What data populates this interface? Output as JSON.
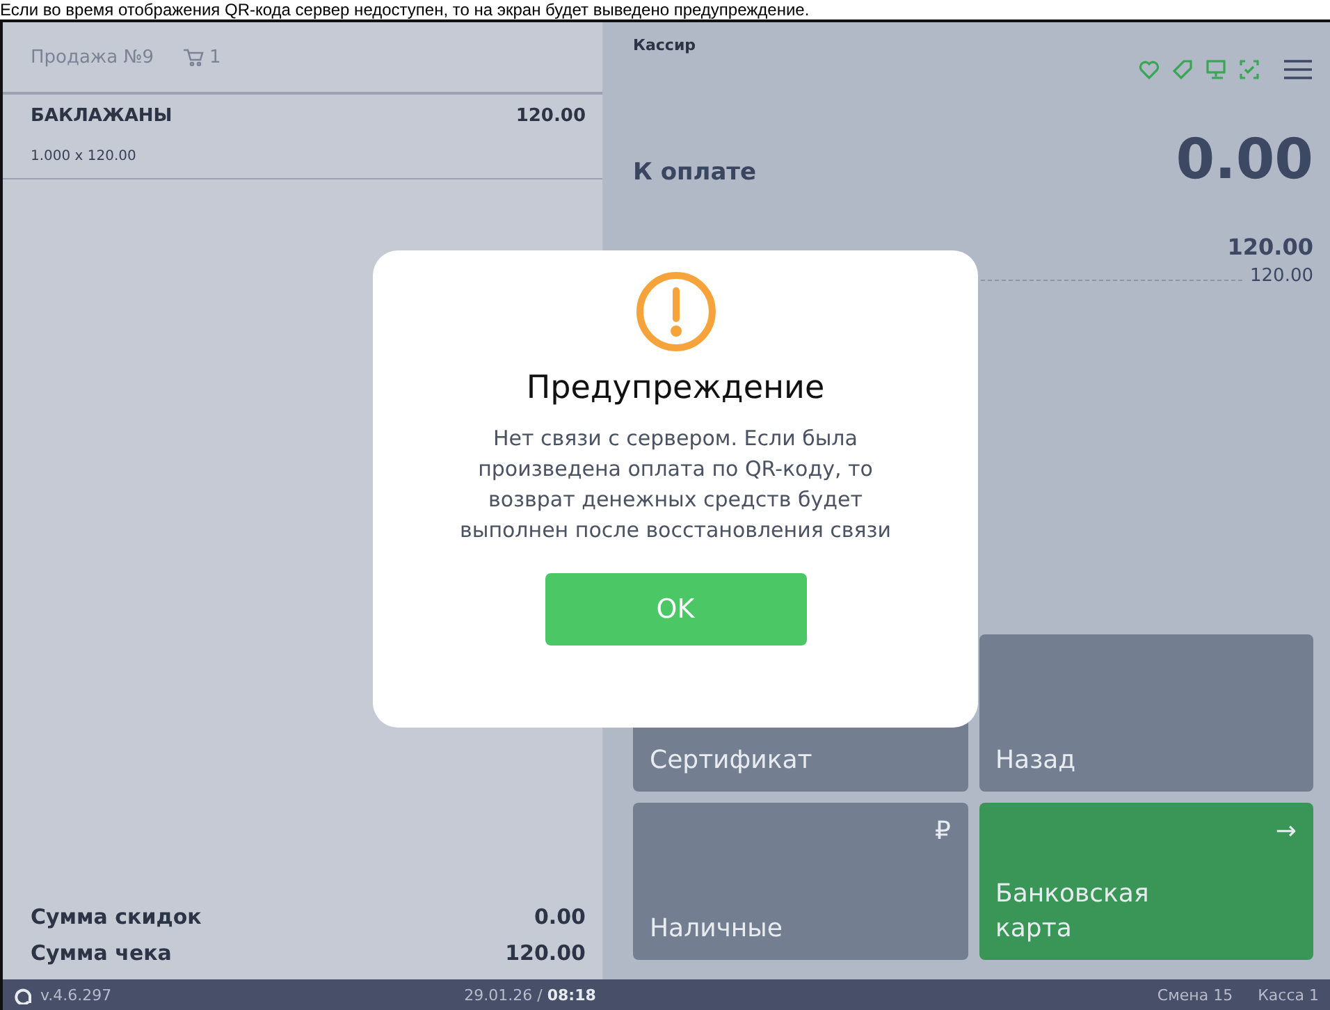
{
  "caption": "Если во время отображения QR-кода сервер недоступен, то на экран будет выведено предупреждение.",
  "sale": {
    "title": "Продажа №9",
    "cart_count": "1"
  },
  "items": [
    {
      "name": "БАКЛАЖАНЫ",
      "amount": "120.00",
      "detail": "1.000 x 120.00"
    }
  ],
  "totals": [
    {
      "label": "Сумма скидок",
      "value": "0.00"
    },
    {
      "label": "Сумма чека",
      "value": "120.00"
    }
  ],
  "cashier": "Кассир",
  "to_pay": {
    "label": "К оплате",
    "value": "0.00"
  },
  "paid": {
    "total": "120.00",
    "line": "120.00"
  },
  "buttons": [
    {
      "label": "Сертификат",
      "kind": "plain"
    },
    {
      "label": "Назад",
      "kind": "plain"
    },
    {
      "label": "Наличные",
      "kind": "cash",
      "icon": "₽"
    },
    {
      "label": "Банковская карта",
      "kind": "card",
      "icon": "→"
    }
  ],
  "dialog": {
    "title": "Предупреждение",
    "message": "Нет связи с сервером. Если была произведена оплата по QR-коду, то возврат денежных средств будет выполнен после восстановления связи",
    "button": "OK"
  },
  "status_bar": {
    "version": "v.4.6.297",
    "date": "29.01.26",
    "separator": "/",
    "time": "08:18",
    "shift": "Смена 15",
    "register": "Касса 1"
  }
}
